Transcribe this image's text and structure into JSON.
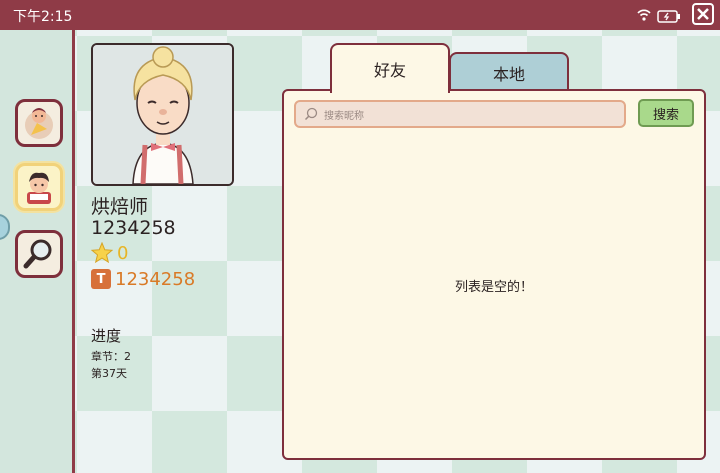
{
  "status_bar": {
    "time": "下午2:15",
    "icons": [
      "wifi-icon",
      "battery-icon"
    ],
    "close_icon": "close-icon",
    "color": "#8f3b47"
  },
  "sidebar": {
    "items": [
      {
        "name": "baker-work-icon",
        "active": false
      },
      {
        "name": "profile-icon",
        "active": true
      },
      {
        "name": "magnifier-icon",
        "active": false
      }
    ]
  },
  "profile": {
    "name": "烘焙师",
    "id": "1234258",
    "stars": "0",
    "coins": "1234258",
    "coin_glyph": "T",
    "progress_title": "进度",
    "chapter": "章节：2",
    "day": "第37天"
  },
  "tabs": [
    {
      "label": "好友",
      "active": true
    },
    {
      "label": "本地",
      "active": false
    }
  ],
  "search": {
    "placeholder": "搜索昵称",
    "button": "搜索"
  },
  "list": {
    "empty_text": "列表是空的！"
  },
  "colors": {
    "accent": "#7e2f3c",
    "panel_bg": "#fdf8e6",
    "search_button": "#a9d98b",
    "star": "#e7b526",
    "coin": "#d97a27"
  }
}
